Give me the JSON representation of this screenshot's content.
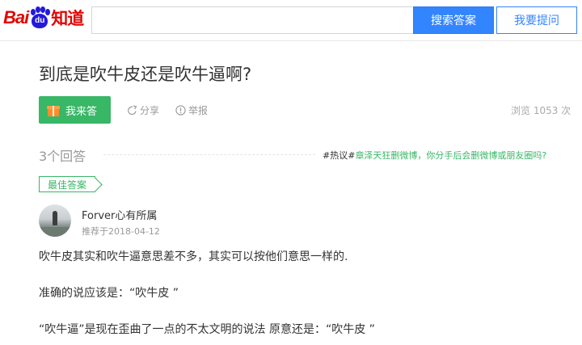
{
  "header": {
    "logo": {
      "bai": "Bai",
      "du": "du",
      "zhidao": "知道"
    },
    "search_placeholder": "",
    "search_button": "搜索答案",
    "ask_button": "我要提问"
  },
  "question": {
    "title": "到底是吹牛皮还是吹牛逼啊?",
    "answer_button": "我来答",
    "share": "分享",
    "report": "举报",
    "views": "浏览 1053 次"
  },
  "answers_header": {
    "count": "3个回答",
    "topic_tag": "#热议#",
    "topic_link": "章泽天狂删微博，你分手后会删微博或朋友圈吗?"
  },
  "best_answer": {
    "badge": "最佳答案",
    "user_name": "Forver心有所属",
    "date": "推荐于2018-04-12",
    "paragraphs": [
      "吹牛皮其实和吹牛逼意思差不多，其实可以按他们意思一样的.",
      "准确的说应该是：“吹牛皮 ”",
      "“吹牛逼”是现在歪曲了一点的不太文明的说法 原意还是：“吹牛皮 ”"
    ]
  },
  "colors": {
    "brand_red": "#e10601",
    "brand_blue": "#2319dc",
    "search_blue": "#3385ff",
    "answer_green": "#38b766"
  }
}
